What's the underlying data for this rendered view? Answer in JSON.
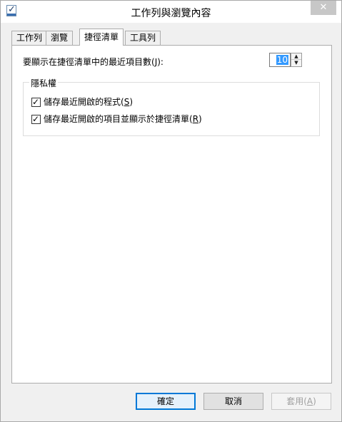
{
  "window": {
    "title": "工作列與瀏覽內容",
    "close_glyph": "✕",
    "icon": "taskbar-properties-icon"
  },
  "tabs": [
    {
      "label": "工作列",
      "active": false
    },
    {
      "label": "瀏覽",
      "active": false
    },
    {
      "label": "捷徑清單",
      "active": true
    },
    {
      "label": "工具列",
      "active": false
    }
  ],
  "jumplist": {
    "count_label_prefix": "要顯示在捷徑清單中的最近項目數(",
    "count_label_key": "J",
    "count_label_suffix": "):",
    "count_value": "10"
  },
  "privacy": {
    "legend": "隱私權",
    "options": [
      {
        "prefix": "儲存最近開啟的程式(",
        "key": "S",
        "suffix": ")",
        "checked": true
      },
      {
        "prefix": "儲存最近開啟的項目並顯示於捷徑清單(",
        "key": "R",
        "suffix": ")",
        "checked": true
      }
    ]
  },
  "buttons": {
    "ok": "確定",
    "cancel": "取消",
    "apply_prefix": "套用(",
    "apply_key": "A",
    "apply_suffix": ")"
  },
  "colors": {
    "selection": "#3399ff",
    "default_button_border": "#0078d7"
  }
}
